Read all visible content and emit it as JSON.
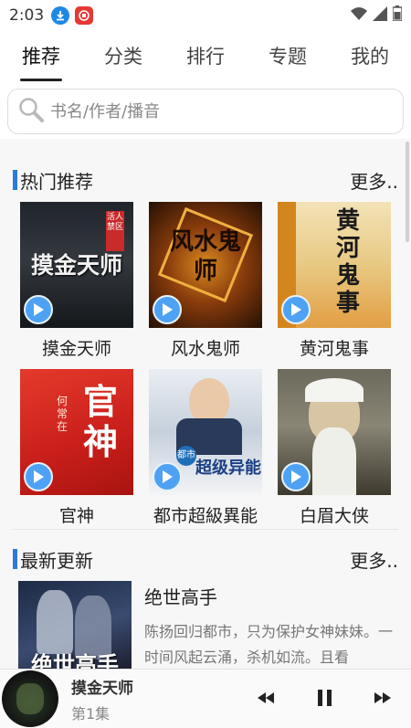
{
  "status_bar": {
    "time": "2:03",
    "icons": [
      "download-icon",
      "app-notification-icon",
      "wifi-icon",
      "signal-icon",
      "battery-icon"
    ]
  },
  "tabs": [
    {
      "label": "推荐",
      "active": true
    },
    {
      "label": "分类",
      "active": false
    },
    {
      "label": "排行",
      "active": false
    },
    {
      "label": "专题",
      "active": false
    },
    {
      "label": "我的",
      "active": false
    }
  ],
  "search": {
    "placeholder": "书名/作者/播音"
  },
  "hot": {
    "title": "热门推荐",
    "more": "更多..",
    "books": [
      {
        "title": "摸金天师",
        "cover_text": "摸金天师",
        "cover_sub": "活人禁区"
      },
      {
        "title": "风水鬼师",
        "cover_text": "风水鬼师",
        "cover_sub": ""
      },
      {
        "title": "黄河鬼事",
        "cover_text": "黄河鬼事",
        "cover_sub": ""
      },
      {
        "title": "官神",
        "cover_text": "官神",
        "cover_sub": "何常在"
      },
      {
        "title": "都市超級異能",
        "cover_text": "超级异能",
        "cover_sub": "都市"
      },
      {
        "title": "白眉大侠",
        "cover_text": "",
        "cover_sub": ""
      }
    ]
  },
  "latest": {
    "title": "最新更新",
    "more": "更多..",
    "item": {
      "title": "绝世高手",
      "desc": "陈扬回归都市，只为保护女神妹妹。一时间风起云涌，杀机如流。且看",
      "cover_text": "绝世高手"
    }
  },
  "player": {
    "title": "摸金天师",
    "episode": "第1集"
  },
  "colors": {
    "accent": "#2d7bd8",
    "play_badge": "#4ea2f4"
  }
}
